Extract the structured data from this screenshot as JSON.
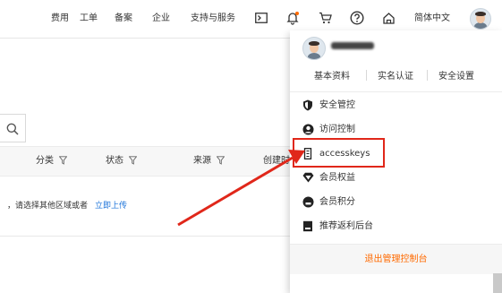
{
  "nav": {
    "items": [
      "费用",
      "工单",
      "备案",
      "企业",
      "支持与服务"
    ],
    "language": "简体中文",
    "icons": [
      "terminal-icon",
      "bell-icon",
      "cart-icon",
      "help-icon",
      "home-icon"
    ]
  },
  "table": {
    "columns": [
      "分类",
      "状态",
      "来源",
      "创建时"
    ],
    "empty_text": "，请选择其他区域或者",
    "empty_link": "立即上传"
  },
  "dropdown": {
    "links": [
      "基本资料",
      "实名认证",
      "安全设置"
    ],
    "menu": [
      {
        "label": "安全管控",
        "icon": "shield-icon"
      },
      {
        "label": "访问控制",
        "icon": "user-circle-icon"
      },
      {
        "label": "accesskeys",
        "icon": "key-icon"
      },
      {
        "label": "会员权益",
        "icon": "diamond-icon"
      },
      {
        "label": "会员积分",
        "icon": "coin-icon"
      },
      {
        "label": "推荐返利后台",
        "icon": "gift-icon"
      }
    ],
    "logout": "退出管理控制台"
  },
  "colors": {
    "accent": "#ff6a00",
    "link": "#1a72d9",
    "annotation": "#e0271a"
  }
}
